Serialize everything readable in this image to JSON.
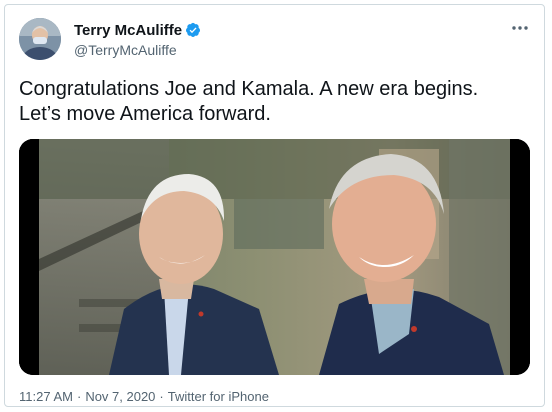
{
  "author": {
    "display_name": "Terry McAuliffe",
    "handle": "@TerryMcAuliffe",
    "verified": true
  },
  "tweet": {
    "text_line1": "Congratulations Joe and Kamala. A new era begins.",
    "text_line2": "Let’s move America forward."
  },
  "meta": {
    "time": "11:27 AM",
    "date": "Nov 7, 2020",
    "separator": "·",
    "source": "Twitter for iPhone"
  },
  "icons": {
    "verified": "verified-badge-icon",
    "more": "more-options-icon"
  },
  "colors": {
    "verified_blue": "#1d9bf0",
    "text_primary": "#0f1419",
    "text_secondary": "#536471",
    "border": "#cfd9de"
  }
}
